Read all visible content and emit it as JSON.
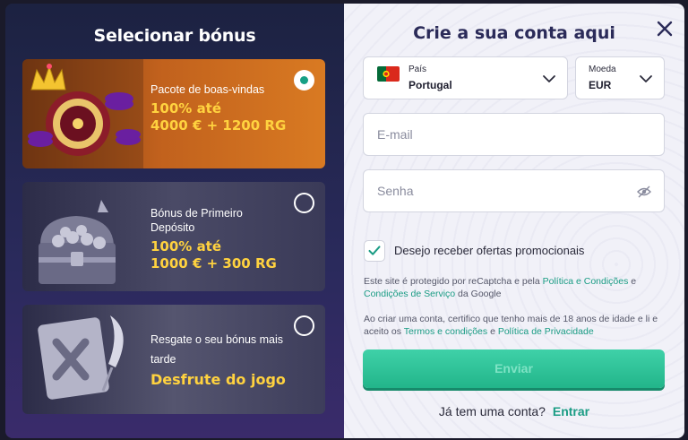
{
  "left": {
    "title": "Selecionar bónus",
    "cards": [
      {
        "subtitle": "Pacote de boas-vindas",
        "highlight_1": "100% até",
        "highlight_2": "4000 € + 1200 RG",
        "selected": true
      },
      {
        "subtitle": "Bónus de Primeiro Depósito",
        "highlight_1": "100% até",
        "highlight_2": "1000 € + 300 RG",
        "selected": false
      },
      {
        "subtitle": "Resgate o seu bónus mais tarde",
        "highlight_1": "Desfrute do jogo",
        "selected": false
      }
    ]
  },
  "right": {
    "title": "Crie a sua conta aqui",
    "country": {
      "label": "País",
      "value": "Portugal"
    },
    "currency": {
      "label": "Moeda",
      "value": "EUR"
    },
    "email_placeholder": "E-mail",
    "password_placeholder": "Senha",
    "promo_label": "Desejo receber ofertas promocionais",
    "promo_checked": true,
    "recaptcha": {
      "text1": "Este site é protegido por reCaptcha e pela ",
      "link1": "Política e Condições",
      "text2": " e ",
      "link2": "Condições de Serviço",
      "text3": " da Google"
    },
    "terms": {
      "text1": "Ao criar uma conta, certifico que tenho mais de 18 anos de idade e li e aceito os ",
      "link1": "Termos e condições",
      "text2": " e ",
      "link2": "Política de Privacidade"
    },
    "submit_label": "Enviar",
    "login_prompt": "Já tem uma conta?",
    "login_link": "Entrar"
  },
  "colors": {
    "accent": "#1a9c84",
    "highlight": "#ffd23f",
    "title": "#2b2b59"
  }
}
